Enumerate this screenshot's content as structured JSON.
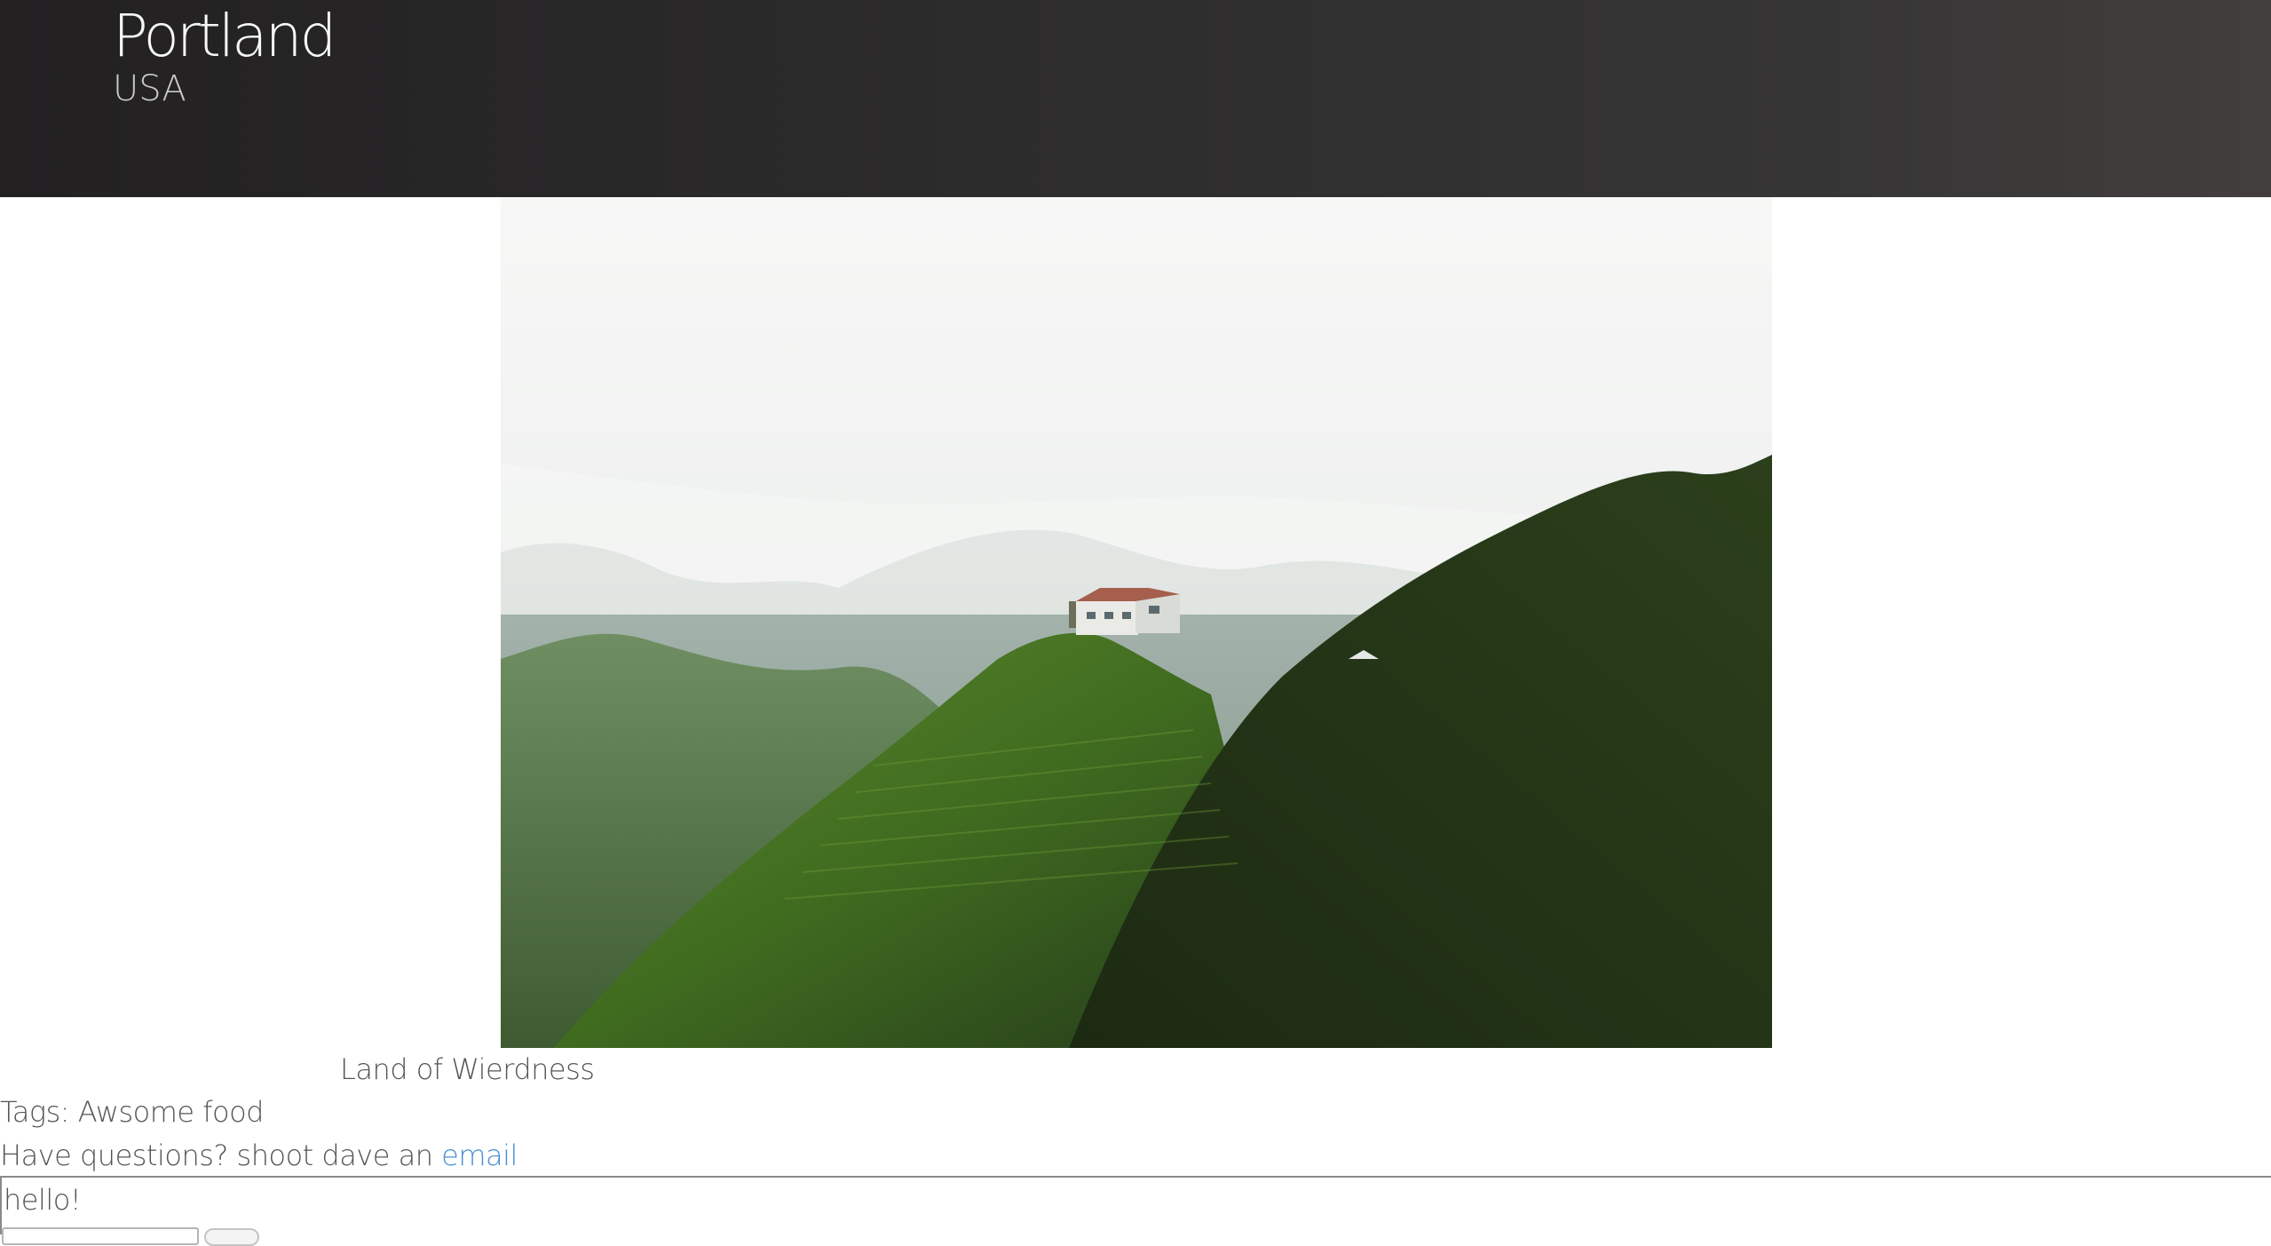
{
  "header": {
    "title": "Portland",
    "subtitle": "USA"
  },
  "photo": {
    "caption": "Land of Wierdness"
  },
  "tags": {
    "prefix": "Tags:",
    "value": "Awsome food"
  },
  "contact": {
    "text": "Have questions? shoot dave an",
    "link_label": "email"
  },
  "comments": {
    "text": "hello!"
  },
  "colors": {
    "header_bg": "#2c2b2c",
    "link": "#4a8fd1",
    "text": "#555555"
  }
}
